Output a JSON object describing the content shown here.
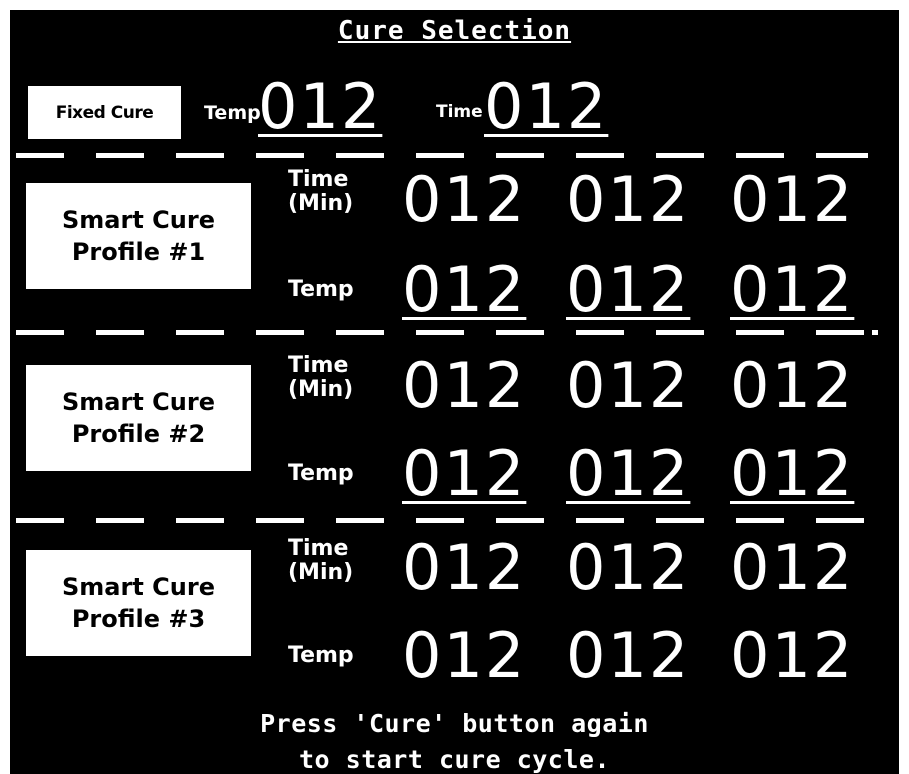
{
  "title": "Cure Selection",
  "fixed": {
    "button_label": "Fixed Cure",
    "temp_label": "Temp",
    "temp_value": "012",
    "time_label": "Time",
    "time_value": "012"
  },
  "profiles": [
    {
      "label_line1": "Smart Cure",
      "label_line2": "Profile #1",
      "time_label_1": "Time",
      "time_label_2": "(Min)",
      "temp_label": "Temp",
      "time_values": [
        "012",
        "012",
        "012"
      ],
      "temp_values": [
        "012",
        "012",
        "012"
      ]
    },
    {
      "label_line1": "Smart Cure",
      "label_line2": "Profile #2",
      "time_label_1": "Time",
      "time_label_2": "(Min)",
      "temp_label": "Temp",
      "time_values": [
        "012",
        "012",
        "012"
      ],
      "temp_values": [
        "012",
        "012",
        "012"
      ]
    },
    {
      "label_line1": "Smart Cure",
      "label_line2": "Profile #3",
      "time_label_1": "Time",
      "time_label_2": "(Min)",
      "temp_label": "Temp",
      "time_values": [
        "012",
        "012",
        "012"
      ],
      "temp_values": [
        "012",
        "012",
        "012"
      ]
    }
  ],
  "footer": {
    "line1": "Press 'Cure' button again",
    "line2": "to start cure cycle."
  },
  "colors": {
    "background": "#000000",
    "foreground": "#ffffff",
    "page": "#ffffff"
  }
}
